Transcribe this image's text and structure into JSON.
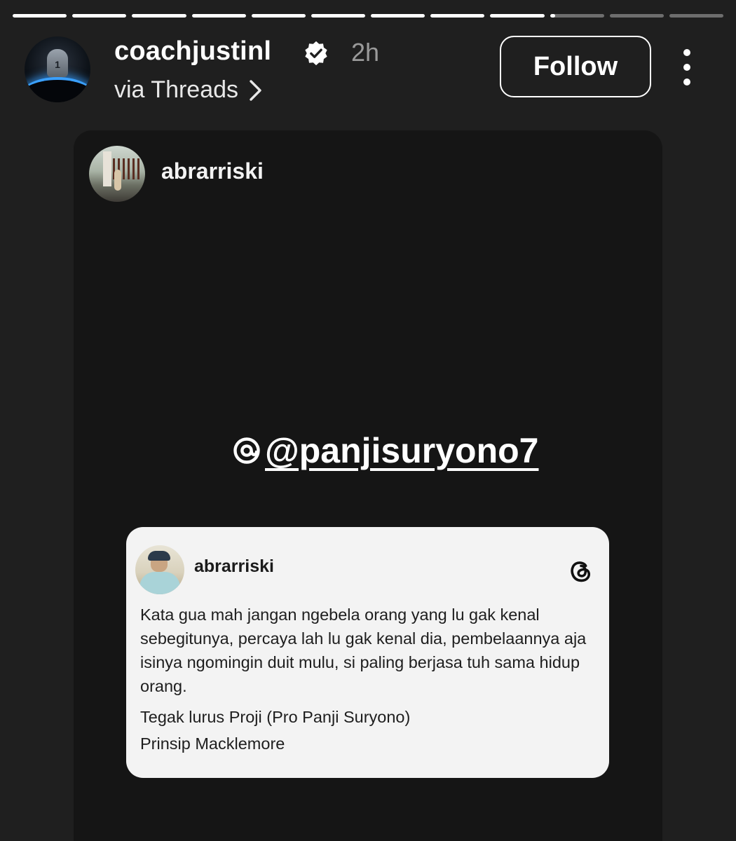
{
  "story": {
    "progress_segments": [
      1,
      1,
      1,
      1,
      1,
      1,
      1,
      1,
      1,
      0.1,
      0,
      0
    ]
  },
  "header": {
    "username": "coachjustinl",
    "verified": true,
    "time": "2h",
    "via": "via Threads",
    "follow_label": "Follow"
  },
  "shared": {
    "author": "abrarriski",
    "mention": "@panjisuryono7"
  },
  "post": {
    "username": "abrarriski",
    "body": "Kata gua mah jangan ngebela orang yang lu gak kenal sebegitunya, percaya lah lu gak kenal dia, pembelaannya aja isinya ngomingin duit mulu, si paling berjasa tuh sama hidup orang.",
    "line2": "Tegak lurus Proji (Pro Panji Suryono)",
    "line3": "Prinsip Macklemore"
  },
  "icons": {
    "verified": "verified-badge-icon",
    "chevron": "chevron-right-icon",
    "more": "more-vertical-icon",
    "threads": "threads-logo-icon"
  }
}
